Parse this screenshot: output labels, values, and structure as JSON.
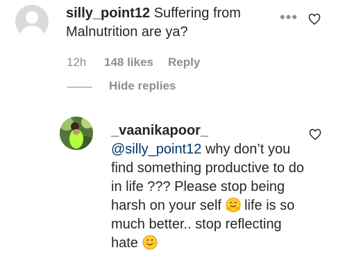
{
  "parent_comment": {
    "username": "silly_point12",
    "text": "Suffering from Malnutrition are ya?",
    "time": "12h",
    "likes": "148 likes",
    "reply_label": "Reply",
    "more_icon": "more-dots-icon",
    "like_icon": "heart-icon"
  },
  "replies_toggle": {
    "label": "Hide replies"
  },
  "reply_comment": {
    "username": "_vaanikapoor_",
    "mention": "@silly_point12",
    "text_before_emoji": "why don’t you find something productive to do in life ??? Please stop being harsh on your self",
    "text_after_emoji": "life is so much better.. stop reflecting hate",
    "emoji1": "hugging-face-emoji",
    "emoji2": "smiling-face-emoji",
    "like_icon": "heart-icon"
  },
  "colors": {
    "text": "#262626",
    "muted": "#8e8e8e",
    "mention": "#00376b",
    "emoji": "#FFCC33"
  }
}
